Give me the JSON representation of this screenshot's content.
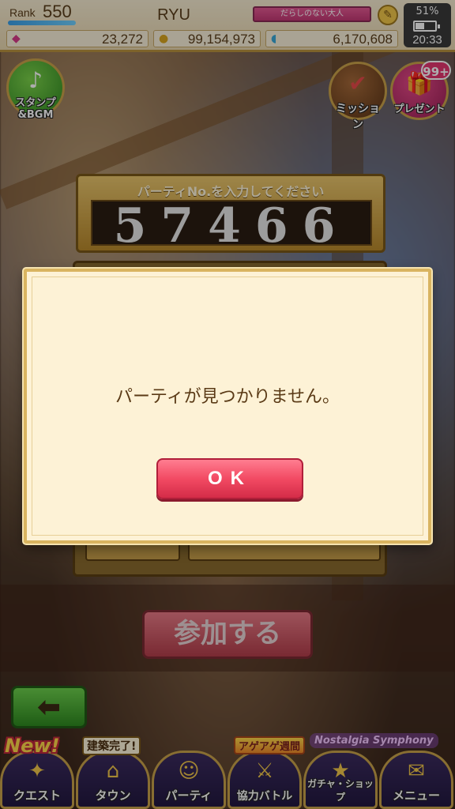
{
  "status": {
    "rank_label": "Rank",
    "rank_value": "550",
    "rank_progress": 1.0,
    "player_name": "RYU",
    "player_title": "だらしのない大人",
    "battery_percent": "51%",
    "battery_level": 0.51,
    "clock": "20:33",
    "currencies": [
      {
        "icon": "gem-icon",
        "value": "23,272"
      },
      {
        "icon": "coin-icon",
        "value": "99,154,973"
      },
      {
        "icon": "drop-icon",
        "value": "6,170,608"
      }
    ]
  },
  "top_buttons": {
    "stamp_label": "スタンプ&BGM",
    "mission_label": "ミッション",
    "present_label": "プレゼント",
    "present_badge": "99+"
  },
  "party": {
    "prompt": "パーティNo.を入力してください",
    "number": "57466",
    "join_label": "参加する"
  },
  "dialog": {
    "message": "パーティが見つかりません。",
    "ok_label": "OK"
  },
  "bottom_nav": {
    "badges": {
      "new": "New!",
      "build": "建築完了!",
      "agage": "アゲアゲ週間",
      "nostalgia": "Nostalgia Symphony"
    },
    "items": [
      {
        "label": "クエスト",
        "icon": "quest-icon"
      },
      {
        "label": "タウン",
        "icon": "town-icon"
      },
      {
        "label": "パーティ",
        "icon": "party-icon"
      },
      {
        "label": "協力バトル",
        "icon": "coop-battle-icon"
      },
      {
        "label": "ガチャ・ショップ",
        "icon": "gacha-shop-icon"
      },
      {
        "label": "メニュー",
        "icon": "menu-icon"
      }
    ]
  },
  "colors": {
    "dialog_bg": "#fdf2d6",
    "ok_button": "#f24a63",
    "back_button": "#2e8a20",
    "title_badge": "#c33874"
  }
}
